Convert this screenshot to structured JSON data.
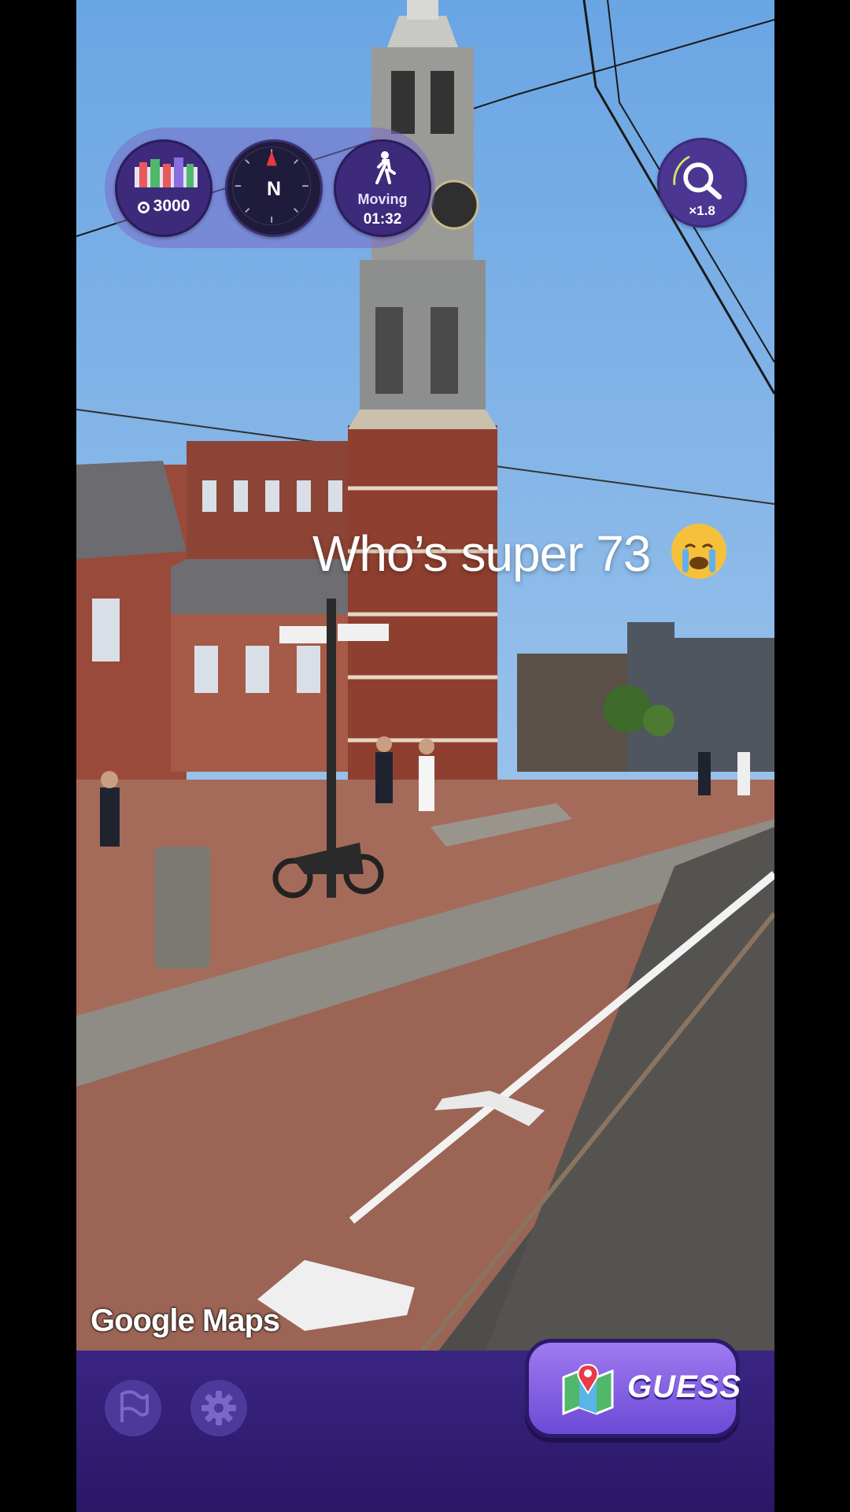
{
  "hud": {
    "score": "3000",
    "compass_heading": "N",
    "movement_label": "Moving",
    "timer": "01:32",
    "zoom_multiplier": "×1.8"
  },
  "caption": "Who’s super 73",
  "caption_emoji": "loudly-crying-face",
  "watermark": "Google Maps",
  "bottom_bar": {
    "guess_label": "GUESS"
  },
  "colors": {
    "hud_bg": "#3d2a7a",
    "bottom_bar": "#2f1b70",
    "guess_button": "#8a66e8",
    "sky": "#7fb2e6"
  }
}
